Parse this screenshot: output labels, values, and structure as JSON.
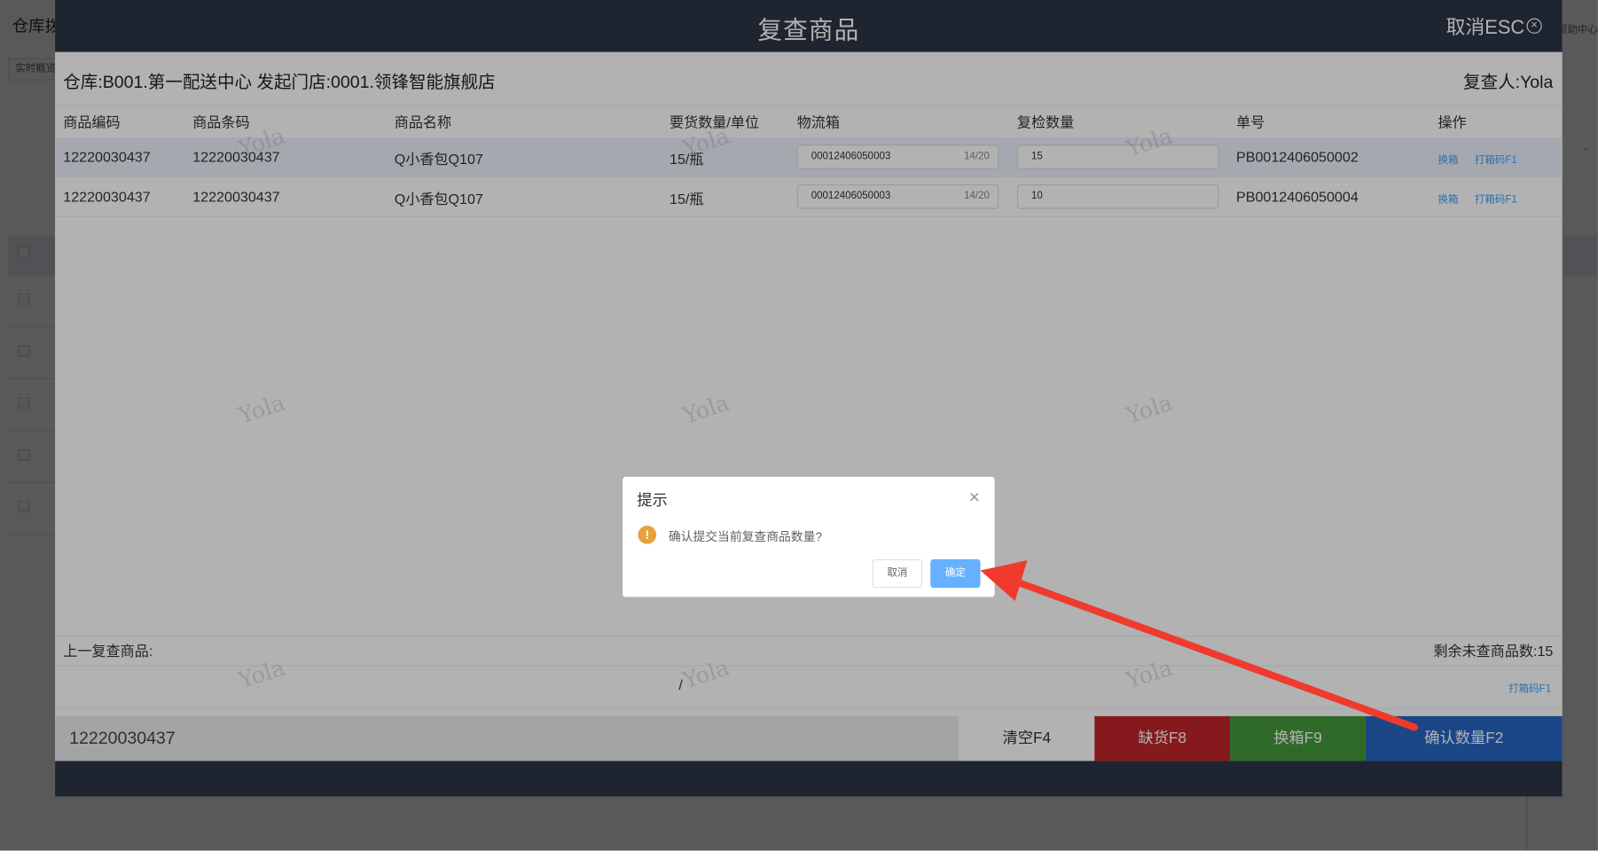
{
  "background": {
    "title": "仓库拨",
    "tab": "实时概览",
    "help": "帮助中心"
  },
  "modal": {
    "title": "复查商品",
    "close_label": "取消ESC",
    "close_icon": "close-circle-icon",
    "info": "仓库:B001.第一配送中心 发起门店:0001.领锋智能旗舰店",
    "reviewer": "复查人:Yola",
    "columns": [
      "商品编码",
      "商品条码",
      "商品名称",
      "要货数量/单位",
      "物流箱",
      "复检数量",
      "单号",
      "操作"
    ],
    "rows": [
      {
        "code": "12220030437",
        "barcode": "12220030437",
        "name": "Q小香包Q107",
        "qty_unit": "15/瓶",
        "box": "00012406050003",
        "box_count": "14/20",
        "check_qty": "15",
        "order_no": "PB0012406050002",
        "op_swap": "换箱",
        "op_print": "打箱码F1"
      },
      {
        "code": "12220030437",
        "barcode": "12220030437",
        "name": "Q小香包Q107",
        "qty_unit": "15/瓶",
        "box": "00012406050003",
        "box_count": "14/20",
        "check_qty": "10",
        "order_no": "PB0012406050004",
        "op_swap": "换箱",
        "op_print": "打箱码F1"
      }
    ],
    "prev_label": "上一复查商品:",
    "remaining": "剩余未查商品数:15",
    "slash": "/",
    "print_bottom": "打箱码F1",
    "scan_value": "12220030437",
    "buttons": {
      "clear": "清空F4",
      "shortage": "缺货F8",
      "swap_box": "换箱F9",
      "confirm": "确认数量F2"
    },
    "watermark": "Yola"
  },
  "dialog": {
    "title": "提示",
    "close_icon": "close-icon",
    "warning_icon": "warning-icon",
    "message": "确认提交当前复查商品数量?",
    "cancel": "取消",
    "ok": "确定"
  },
  "colors": {
    "header": "#2b3547",
    "shortage": "#c0242a",
    "swap": "#45993a",
    "confirm": "#2766c2",
    "ok_button": "#66b1ff",
    "arrow": "#f03a2e"
  }
}
